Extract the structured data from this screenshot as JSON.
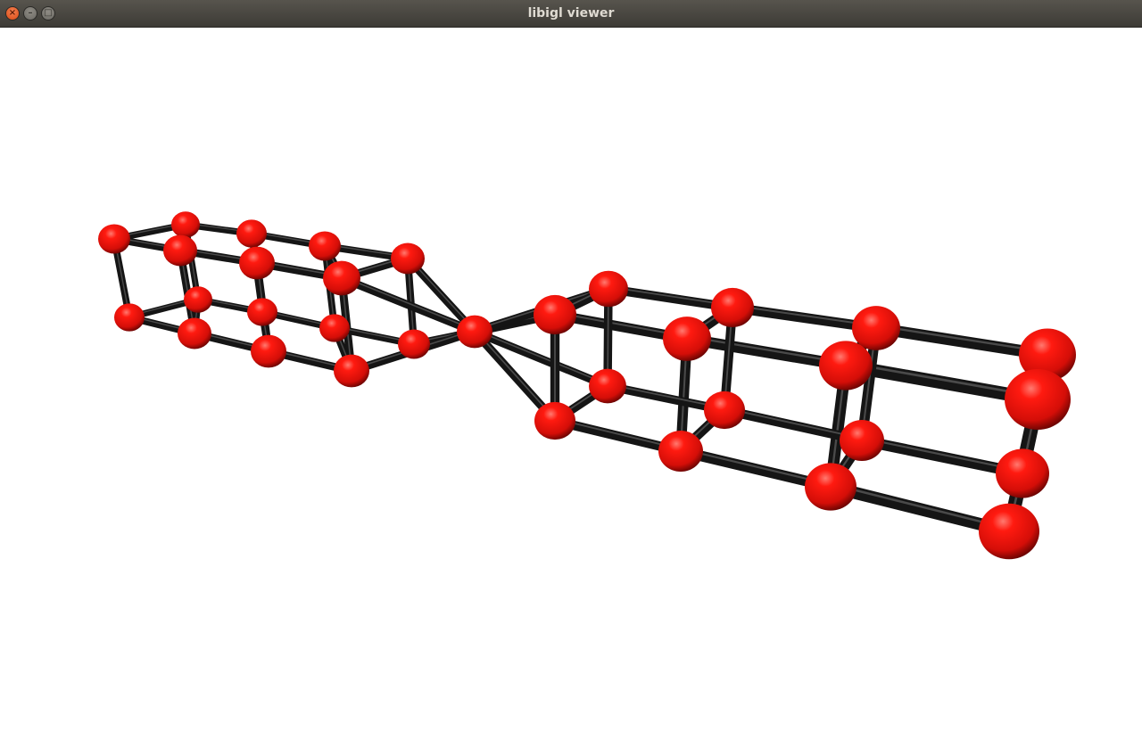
{
  "window": {
    "title": "libigl viewer",
    "close_glyph": "×",
    "minimize_glyph": "–",
    "maximize_glyph": "□"
  },
  "scene": {
    "node_color": "#e8120c",
    "edge_color": "#151515",
    "background": "#ffffff"
  }
}
